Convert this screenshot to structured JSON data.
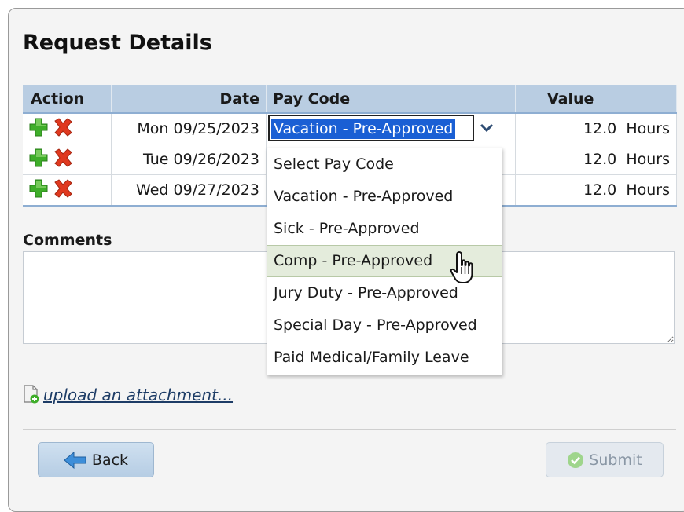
{
  "title": "Request Details",
  "table": {
    "headers": {
      "action": "Action",
      "date": "Date",
      "pay_code": "Pay Code",
      "value": "Value"
    },
    "rows": [
      {
        "date": "Mon 09/25/2023",
        "value": "12.0  Hours"
      },
      {
        "date": "Tue 09/26/2023",
        "value": "12.0  Hours"
      },
      {
        "date": "Wed 09/27/2023",
        "value": "12.0  Hours"
      }
    ]
  },
  "pay_code_select": {
    "selected": "Vacation - Pre-Approved",
    "options": [
      "Select Pay Code",
      "Vacation - Pre-Approved",
      "Sick - Pre-Approved",
      "Comp - Pre-Approved",
      "Jury Duty - Pre-Approved",
      "Special Day - Pre-Approved",
      "Paid Medical/Family Leave"
    ],
    "hovered_option": "Comp - Pre-Approved"
  },
  "comments": {
    "label": "Comments",
    "value": ""
  },
  "upload_link": "upload an attachment...",
  "buttons": {
    "back": "Back",
    "submit": "Submit"
  },
  "colors": {
    "header_bg": "#b9cde2",
    "selection_bg": "#1a5fd4",
    "hover_bg": "#e4ecdc",
    "add_green": "#3fae2a",
    "remove_red": "#e0391f"
  }
}
